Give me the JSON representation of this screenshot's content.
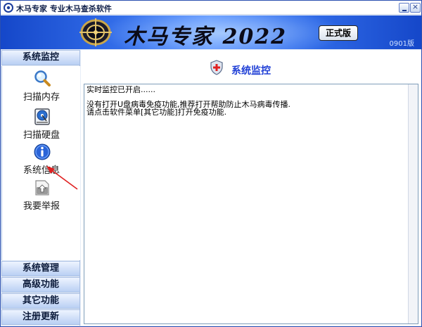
{
  "window": {
    "title": "木马专家  专业木马查杀软件",
    "minimize_icon": "minimize-icon",
    "close_glyph": "×"
  },
  "banner": {
    "product_name": "木马专家 2022",
    "edition": "正式版",
    "version": "0901版",
    "colors": {
      "primary": "#2f69e6",
      "dark": "#1547c9",
      "light": "#5b93ff"
    }
  },
  "sidebar": {
    "active_section": "系统监控",
    "tools": [
      {
        "label": "扫描内存",
        "icon": "magnifier-icon"
      },
      {
        "label": "扫描硬盘",
        "icon": "hard-disk-icon"
      },
      {
        "label": "系统信息",
        "icon": "info-icon"
      },
      {
        "label": "我要举报",
        "icon": "report-upload-icon"
      }
    ],
    "sections": [
      "系统管理",
      "高级功能",
      "其它功能",
      "注册更新"
    ]
  },
  "main": {
    "title": "系统监控",
    "title_icon": "shield-icon",
    "title_color": "#1f3fd6",
    "log": [
      "实时监控已开启......",
      "",
      "没有打开U盘病毒免疫功能,推荐打开帮助防止木马病毒传播.",
      "请点击软件菜单[其它功能]打开免疫功能."
    ]
  },
  "annotation": {
    "arrow_color": "#e02020"
  }
}
